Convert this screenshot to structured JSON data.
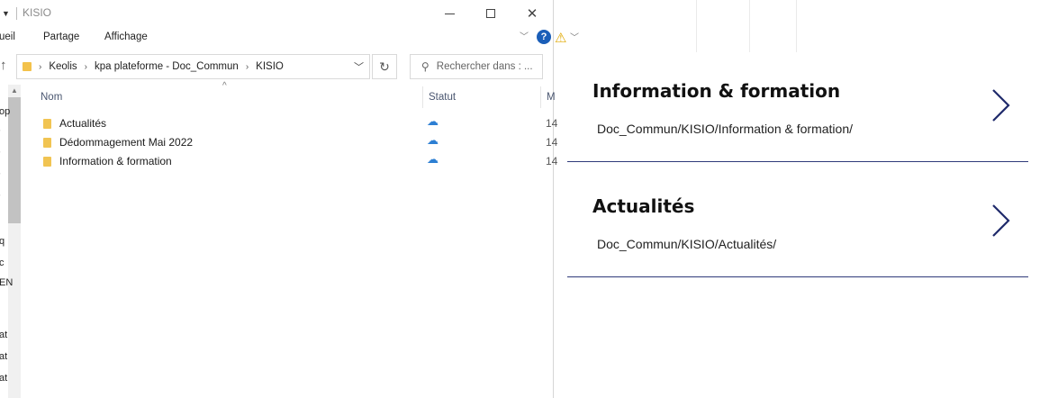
{
  "explorer": {
    "title": "KISIO",
    "ribbon_tabs": [
      "ueil",
      "Partage",
      "Affichage"
    ],
    "breadcrumb": [
      "Keolis",
      "kpa plateforme - Doc_Commun",
      "KISIO"
    ],
    "search_placeholder": "Rechercher dans : ...",
    "columns": {
      "name": "Nom",
      "status": "Statut",
      "modified": "M"
    },
    "files": [
      {
        "name": "Actualités",
        "status_icon": "cloud-icon",
        "date": "14"
      },
      {
        "name": "Dédommagement Mai 2022",
        "status_icon": "cloud-icon",
        "date": "14"
      },
      {
        "name": "Information & formation",
        "status_icon": "cloud-icon",
        "date": "14"
      }
    ],
    "left_pane_cut_text": [
      "op",
      "q",
      "c",
      "EN",
      "at",
      "at",
      "at"
    ]
  },
  "help_icon_label": "?",
  "cards": [
    {
      "title": "Information & formation",
      "path": "Doc_Commun/KISIO/Information & formation/"
    },
    {
      "title": "Actualités",
      "path": "Doc_Commun/KISIO/Actualités/"
    }
  ],
  "colors": {
    "accent_line": "#2f3a7a",
    "chevron": "#1f2a6b",
    "folder": "#f1c452",
    "cloud": "#2d7fd3"
  }
}
